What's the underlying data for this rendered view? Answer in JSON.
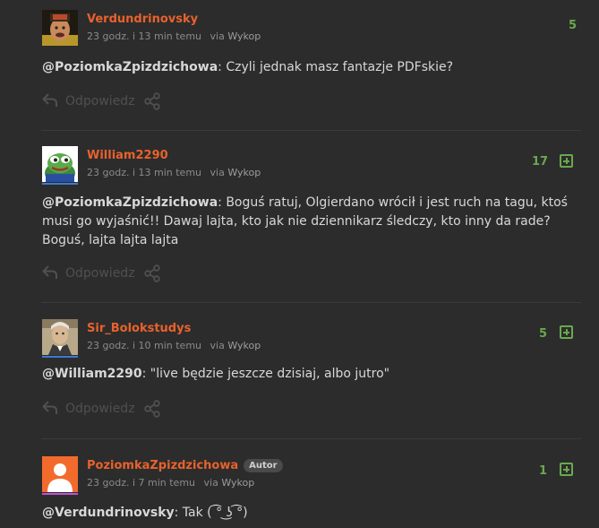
{
  "comments": [
    {
      "username": "Verdundrinovsky",
      "time": "23 godz. i 13 min temu",
      "via_prefix": "via",
      "via_source": "Wykop",
      "votes": "5",
      "mention": "@PoziomkaZpizdzichowa",
      "text": ": Czyli jednak masz fantazje PDFskie?",
      "reply_label": "Odpowiedz"
    },
    {
      "username": "William2290",
      "time": "23 godz. i 13 min temu",
      "via_prefix": "via",
      "via_source": "Wykop",
      "votes": "17",
      "mention": "@PoziomkaZpizdzichowa",
      "text": ": Boguś ratuj, Olgierdano wrócił i jest ruch na tagu, ktoś musi go wyjaśnić!! Dawaj lajta, kto jak nie dziennikarz śledczy, kto inny da rade? Boguś, lajta lajta lajta",
      "reply_label": "Odpowiedz"
    },
    {
      "username": "Sir_Bolokstudys",
      "time": "23 godz. i 10 min temu",
      "via_prefix": "via",
      "via_source": "Wykop",
      "votes": "5",
      "mention": "@William2290",
      "text": ": \"live będzie jeszcze dzisiaj, albo jutro\"",
      "reply_label": "Odpowiedz"
    },
    {
      "username": "PoziomkaZpizdzichowa",
      "badge": "Autor",
      "time": "23 godz. i 7 min temu",
      "via_prefix": "via",
      "via_source": "Wykop",
      "votes": "1",
      "mention": "@Verdundrinovsky",
      "text": ": Tak ( ͡° ͜ʖ ͡°)"
    }
  ],
  "colors": {
    "background": "#2c2c2c",
    "username": "#e8622c",
    "vote_green": "#6aa84f",
    "avatar_line_blue": "#3a7bd5",
    "avatar_line_pink": "#c44fd6"
  }
}
